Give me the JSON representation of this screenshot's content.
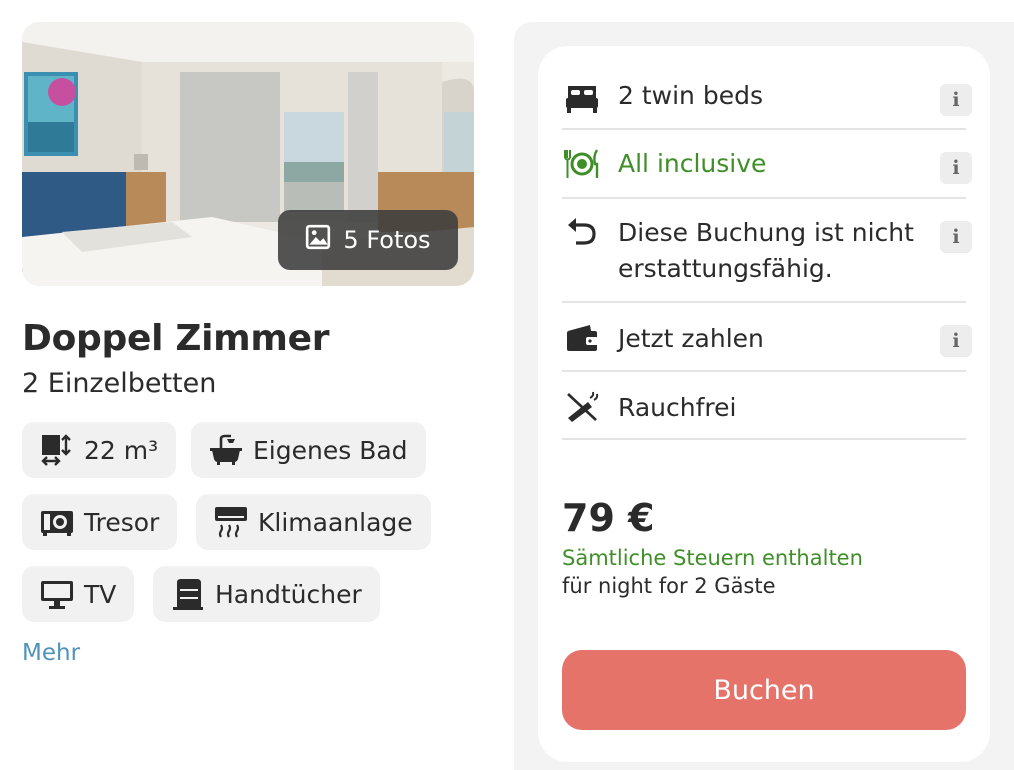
{
  "room": {
    "photos_label": "5 Fotos",
    "title": "Doppel Zimmer",
    "subtitle": "2 Einzelbetten",
    "amenities": [
      {
        "icon": "room-size-icon",
        "label": "22 m³"
      },
      {
        "icon": "bathtub-icon",
        "label": "Eigenes Bad"
      },
      {
        "icon": "safe-icon",
        "label": "Tresor"
      },
      {
        "icon": "air-conditioning-icon",
        "label": "Klimaanlage"
      },
      {
        "icon": "tv-icon",
        "label": "TV"
      },
      {
        "icon": "towels-icon",
        "label": "Handtücher"
      }
    ],
    "more_link": "Mehr"
  },
  "offer": {
    "features": [
      {
        "icon": "bed-icon",
        "label": "2 twin beds",
        "info": "i"
      },
      {
        "icon": "meal-icon",
        "label": "All inclusive",
        "info": "i"
      },
      {
        "icon": "undo-icon",
        "label": "Diese Buchung ist nicht erstattungsfähig.",
        "info": "i"
      },
      {
        "icon": "wallet-icon",
        "label": "Jetzt zahlen",
        "info": "i"
      },
      {
        "icon": "no-smoking-icon",
        "label": "Rauchfrei"
      }
    ],
    "price": "79 €",
    "tax_note": "Sämtliche Steuern enthalten",
    "per_note": "für night for 2 Gäste",
    "book_label": "Buchen"
  },
  "colors": {
    "accent_green": "#3e8f27",
    "book_button": "#e5736a",
    "link_blue": "#4f93b8"
  }
}
